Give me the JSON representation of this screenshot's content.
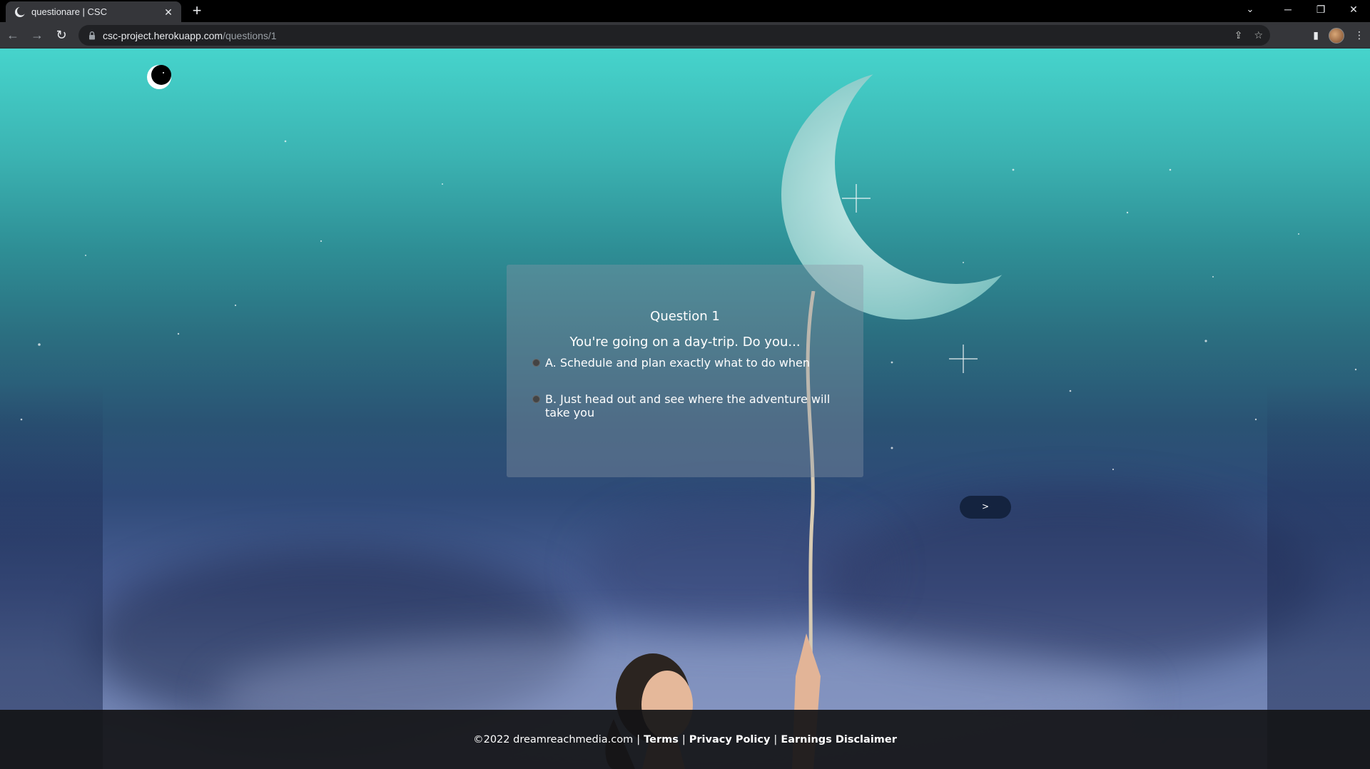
{
  "browser": {
    "tab": {
      "title": "questionare | CSC"
    },
    "url": {
      "host": "csc-project.herokuapp.com",
      "path": "/questions/1"
    }
  },
  "quiz": {
    "heading": "Question 1",
    "question": "You're going on a day-trip. Do you...",
    "options": [
      {
        "label": "A. Schedule and plan exactly what to do when"
      },
      {
        "label": "B. Just head out and see where the adventure will take you"
      }
    ],
    "next_label": ">"
  },
  "footer": {
    "copyright": "©2022 dreamreachmedia.com",
    "links": [
      "Terms",
      "Privacy Policy",
      "Earnings Disclaimer"
    ],
    "separator": "|"
  },
  "icons": {
    "favicon": "moon-logo-icon",
    "site_logo": "moon-logo-icon",
    "lock": "lock-icon"
  }
}
